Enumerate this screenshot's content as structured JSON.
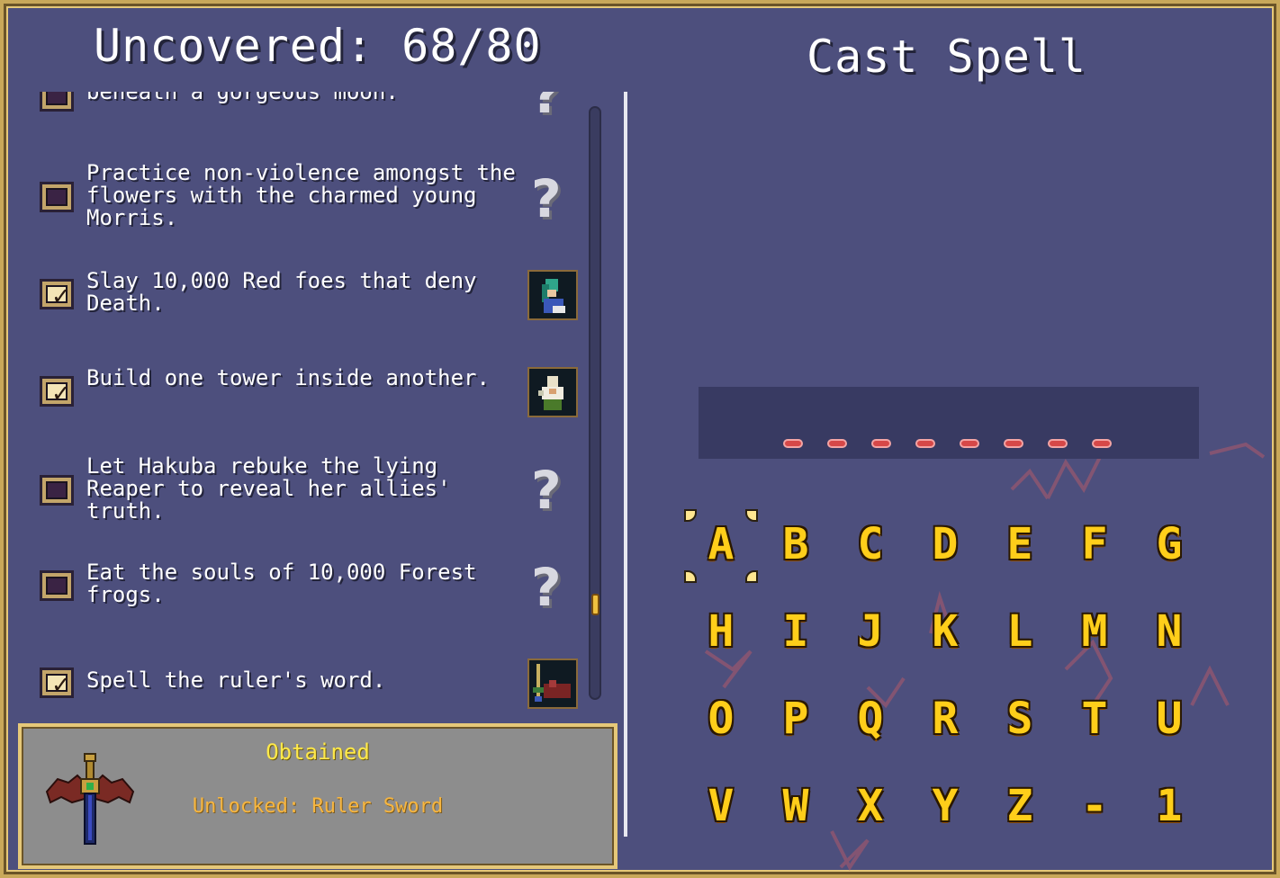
{
  "achievements_panel": {
    "counter_label": "Uncovered: 68/80",
    "items": [
      {
        "text": "beneath a gorgeous moon.",
        "checked": false,
        "reward": "hidden"
      },
      {
        "text": "Practice non-violence amongst the flowers with the charmed young Morris.",
        "checked": false,
        "reward": "hidden"
      },
      {
        "text": "Slay 10,000 Red foes that deny Death.",
        "checked": true,
        "reward": "portrait"
      },
      {
        "text": "Build one tower inside another.",
        "checked": true,
        "reward": "portrait"
      },
      {
        "text": "Let Hakuba rebuke the lying Reaper to reveal her allies' truth.",
        "checked": false,
        "reward": "hidden"
      },
      {
        "text": "Eat the souls of 10,000 Forest frogs.",
        "checked": false,
        "reward": "hidden"
      },
      {
        "text": "Spell the ruler's word.",
        "checked": true,
        "reward": "portrait"
      }
    ],
    "hidden_reward_glyph": "?",
    "check_glyph": "✓"
  },
  "obtained_box": {
    "title": "Obtained",
    "unlocked_text": "Unlocked: Ruler Sword"
  },
  "spell_panel": {
    "title": "Cast Spell",
    "slot_count": 8,
    "keys": [
      [
        "A",
        "B",
        "C",
        "D",
        "E",
        "F",
        "G"
      ],
      [
        "H",
        "I",
        "J",
        "K",
        "L",
        "M",
        "N"
      ],
      [
        "O",
        "P",
        "Q",
        "R",
        "S",
        "T",
        "U"
      ],
      [
        "V",
        "W",
        "X",
        "Y",
        "Z",
        "-",
        "1"
      ]
    ],
    "selected_key": "A"
  },
  "colors": {
    "background": "#4d4f7d",
    "border_gold": "#c9a85a",
    "key_yellow": "#ffce1a",
    "obtained_yellow": "#ffe94a",
    "unlocked_orange": "#f7b640",
    "slot_red": "#d64848"
  }
}
